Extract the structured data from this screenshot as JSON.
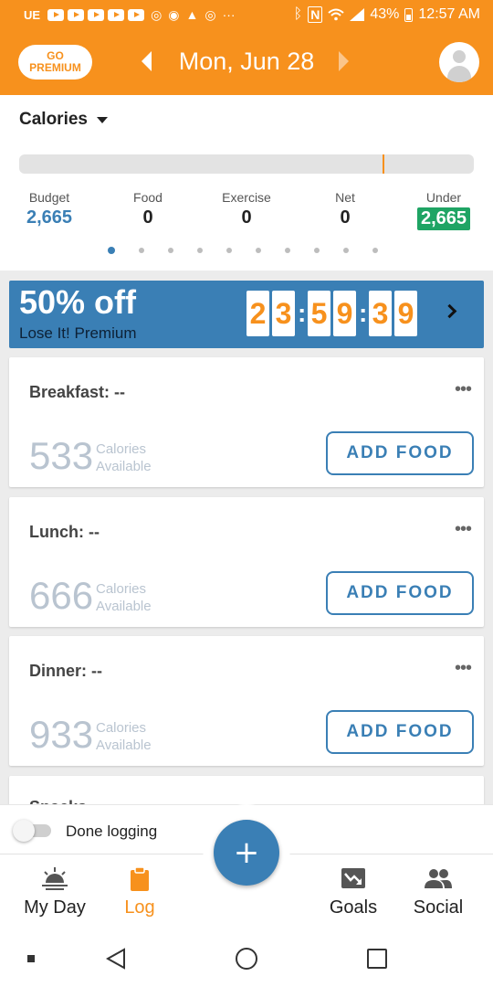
{
  "status_bar": {
    "carrier": "UE",
    "battery": "43%",
    "time": "12:57 AM",
    "icons": [
      "youtube-icon",
      "youtube-icon",
      "youtube-icon",
      "youtube-icon",
      "youtube-icon",
      "instagram-icon",
      "chrome-icon",
      "warning-icon",
      "instagram-icon",
      "more-icon",
      "bluetooth-icon",
      "nfc-icon",
      "wifi-icon",
      "signal-icon",
      "battery-icon"
    ]
  },
  "header": {
    "premium_line1": "GO",
    "premium_line2": "PREMIUM",
    "date": "Mon, Jun 28",
    "accent_color": "#f7911d"
  },
  "summary": {
    "dropdown_label": "Calories",
    "progress_fraction": 0.8,
    "stats": [
      {
        "label": "Budget",
        "value": "2,665"
      },
      {
        "label": "Food",
        "value": "0"
      },
      {
        "label": "Exercise",
        "value": "0"
      },
      {
        "label": "Net",
        "value": "0"
      },
      {
        "label": "Under",
        "value": "2,665"
      }
    ],
    "page_count": 10,
    "active_page": 0
  },
  "promo": {
    "title": "50% off",
    "subtitle": "Lose It! Premium",
    "timer_digits": [
      "2",
      "3",
      "5",
      "9",
      "3",
      "9"
    ],
    "timer_separator": ":",
    "color": "#3a7fb5"
  },
  "meals": [
    {
      "title": "Breakfast: --",
      "calories": "533",
      "cal_label_1": "Calories",
      "cal_label_2": "Available",
      "button": "ADD FOOD"
    },
    {
      "title": "Lunch: --",
      "calories": "666",
      "cal_label_1": "Calories",
      "cal_label_2": "Available",
      "button": "ADD FOOD"
    },
    {
      "title": "Dinner: --",
      "calories": "933",
      "cal_label_1": "Calories",
      "cal_label_2": "Available",
      "button": "ADD FOOD"
    }
  ],
  "meal_more_glyph": "•••",
  "partial_meal_peek": "Snacks",
  "done_logging": {
    "label": "Done logging",
    "enabled": false
  },
  "fab_glyph": "+",
  "bottom_nav": [
    {
      "label": "My Day",
      "icon": "sunrise-icon"
    },
    {
      "label": "Log",
      "icon": "clipboard-icon",
      "active": true
    },
    {
      "label": "Goals",
      "icon": "chart-down-icon"
    },
    {
      "label": "Social",
      "icon": "people-icon"
    }
  ]
}
